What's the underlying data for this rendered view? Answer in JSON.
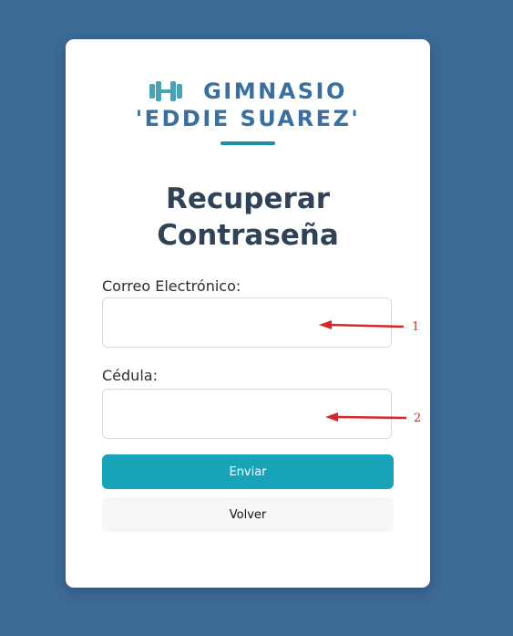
{
  "brand": {
    "line1": "GIMNASIO",
    "line2": "'EDDIE SUAREZ'",
    "icon": "dumbbell-icon",
    "color": "#3a6fa0",
    "accent": "#1a8fa6"
  },
  "form": {
    "title_line1": "Recuperar",
    "title_line2": "Contraseña",
    "email_label": "Correo Electrónico:",
    "email_value": "",
    "cedula_label": "Cédula:",
    "cedula_value": "",
    "submit_label": "Enviar",
    "back_label": "Volver"
  },
  "annotations": {
    "marker_1": "1",
    "marker_2": "2",
    "color": "#d62828"
  },
  "colors": {
    "background": "#3d6a96",
    "primary_button": "#18a3b8",
    "title": "#2f4256"
  }
}
